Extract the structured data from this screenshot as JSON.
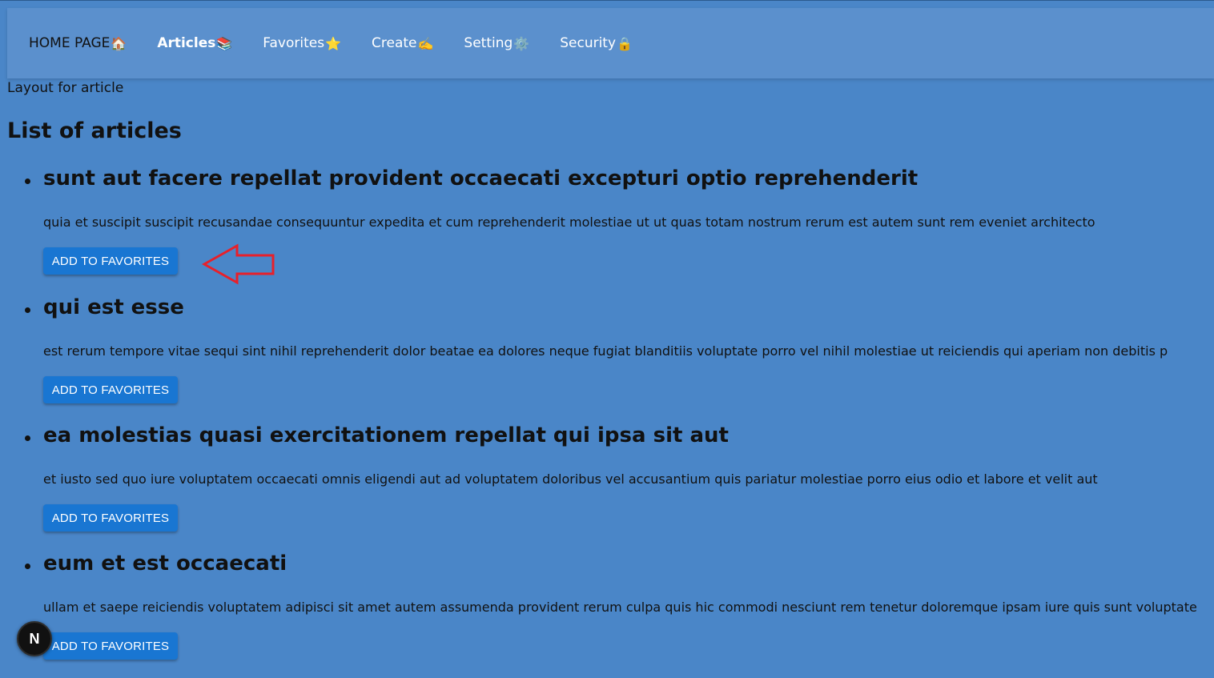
{
  "nav": {
    "items": [
      {
        "label": "HOME PAGE",
        "emoji": "🏠"
      },
      {
        "label": "Articles",
        "emoji": "📚"
      },
      {
        "label": "Favorites",
        "emoji": "⭐"
      },
      {
        "label": "Create",
        "emoji": "✍️"
      },
      {
        "label": "Setting",
        "emoji": "⚙️"
      },
      {
        "label": "Security",
        "emoji": "🔒"
      }
    ]
  },
  "layout_label": "Layout for article",
  "list_title": "List of articles",
  "articles": [
    {
      "title": "sunt aut facere repellat provident occaecati excepturi optio reprehenderit",
      "body": "quia et suscipit suscipit recusandae consequuntur expedita et cum reprehenderit molestiae ut ut quas totam nostrum rerum est autem sunt rem eveniet architecto",
      "button": "ADD TO FAVORITES"
    },
    {
      "title": "qui est esse",
      "body": "est rerum tempore vitae sequi sint nihil reprehenderit dolor beatae ea dolores neque fugiat blanditiis voluptate porro vel nihil molestiae ut reiciendis qui aperiam non debitis p",
      "button": "ADD TO FAVORITES"
    },
    {
      "title": "ea molestias quasi exercitationem repellat qui ipsa sit aut",
      "body": "et iusto sed quo iure voluptatem occaecati omnis eligendi aut ad voluptatem doloribus vel accusantium quis pariatur molestiae porro eius odio et labore et velit aut",
      "button": "ADD TO FAVORITES"
    },
    {
      "title": "eum et est occaecati",
      "body": "ullam et saepe reiciendis voluptatem adipisci sit amet autem assumenda provident rerum culpa quis hic commodi nesciunt rem tenetur doloremque ipsam iure quis sunt voluptate",
      "button": "ADD TO FAVORITES"
    }
  ],
  "badge": {
    "letter": "N",
    "icon": "nextjs-icon"
  },
  "annotation": {
    "icon": "red-arrow-left-icon",
    "color": "#e8202a"
  },
  "colors": {
    "background": "#4a86c8",
    "navbar": "#5b90cd",
    "button": "#1976d2"
  }
}
